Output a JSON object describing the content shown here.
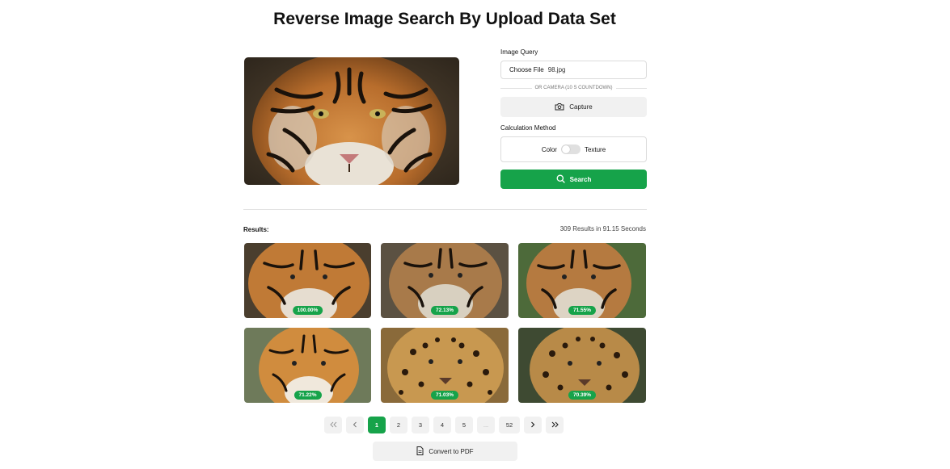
{
  "page": {
    "title": "Reverse Image Search By Upload Data Set"
  },
  "query_image": {
    "subject": "tiger face"
  },
  "form": {
    "image_query_label": "Image Query",
    "file_button_label": "Choose File",
    "file_name": "98.jpg",
    "divider_text": "OR CAMERA (10 S COUNTDOWN)",
    "capture_label": "Capture",
    "calculation_label": "Calculation Method",
    "option_left": "Color",
    "option_right": "Texture",
    "toggle_state": "Color",
    "search_label": "Search"
  },
  "results": {
    "label": "Results:",
    "stats": "309 Results in 91.15 Seconds",
    "items": [
      {
        "score": "100.00%",
        "subject": "tiger"
      },
      {
        "score": "72.13%",
        "subject": "tiger"
      },
      {
        "score": "71.55%",
        "subject": "tiger"
      },
      {
        "score": "71.22%",
        "subject": "tiger"
      },
      {
        "score": "71.03%",
        "subject": "jaguar"
      },
      {
        "score": "70.39%",
        "subject": "jaguar"
      }
    ]
  },
  "pagination": {
    "first_icon": "double-chevron-left-icon",
    "prev_icon": "chevron-left-icon",
    "pages": [
      "1",
      "2",
      "3",
      "4",
      "5"
    ],
    "current": "1",
    "ellipsis": "...",
    "last_page": "52",
    "next_icon": "chevron-right-icon",
    "last_icon": "double-chevron-right-icon"
  },
  "export": {
    "pdf_label": "Convert to PDF"
  },
  "colors": {
    "accent": "#16a34a"
  }
}
